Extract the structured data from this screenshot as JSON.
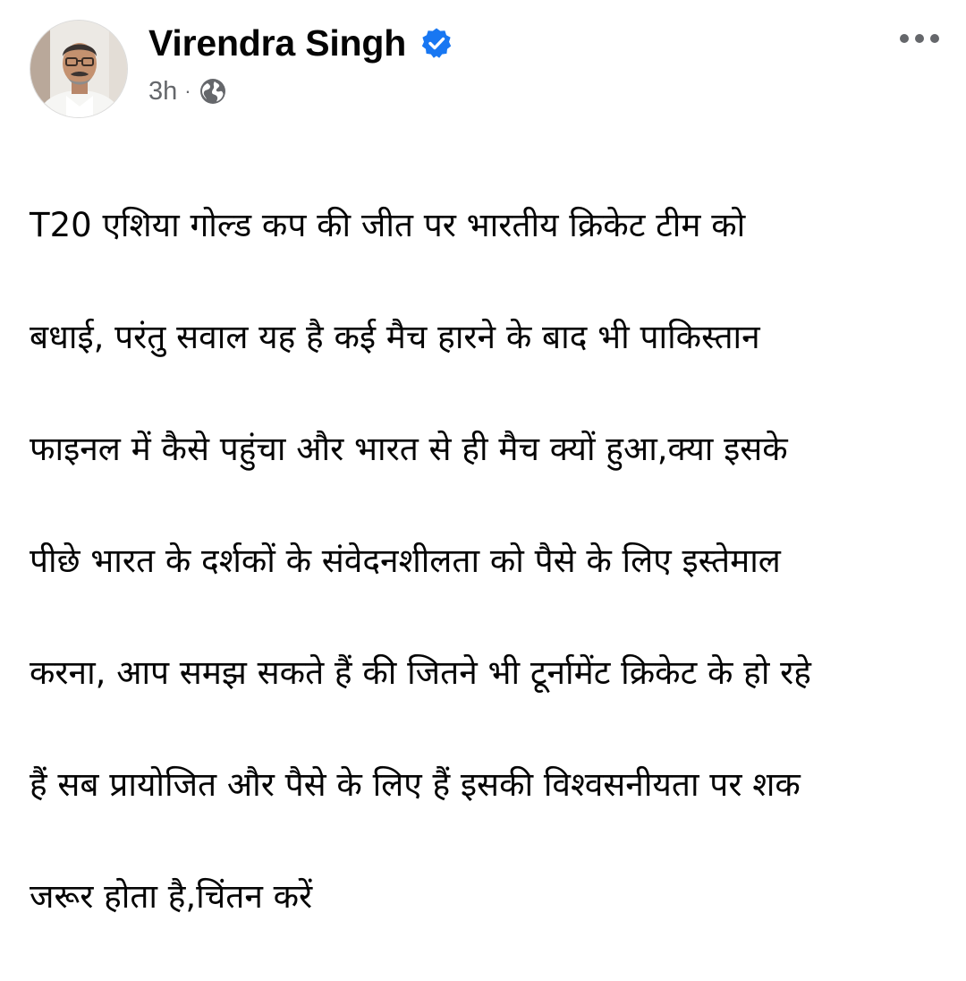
{
  "post": {
    "author": {
      "name": "Virendra Singh",
      "verified": true,
      "avatar": "profile-photo"
    },
    "timestamp": "3h",
    "separator": "·",
    "privacy_icon": "globe-icon",
    "more_icon": "more-options-icon",
    "lines": [
      "T20 एशिया गोल्ड कप की जीत पर भारतीय क्रिकेट टीम को",
      "बधाई, परंतु सवाल यह है कई मैच हारने के बाद भी पाकिस्तान",
      "फाइनल में कैसे पहुंचा और भारत से ही मैच क्यों हुआ,क्या इसके",
      "पीछे भारत के दर्शकों के संवेदनशीलता को पैसे के लिए इस्तेमाल",
      "करना, आप समझ सकते हैं की जितने भी टूर्नामेंट क्रिकेट के हो रहे",
      "हैं सब प्रायोजित और पैसे के लिए हैं इसकी विश्वसनीयता पर शक",
      "जरूर होता है,चिंतन करें"
    ]
  },
  "colors": {
    "background": "#ffffff",
    "text_primary": "#050505",
    "text_secondary": "#65676b",
    "verified_badge": "#1877f2"
  }
}
